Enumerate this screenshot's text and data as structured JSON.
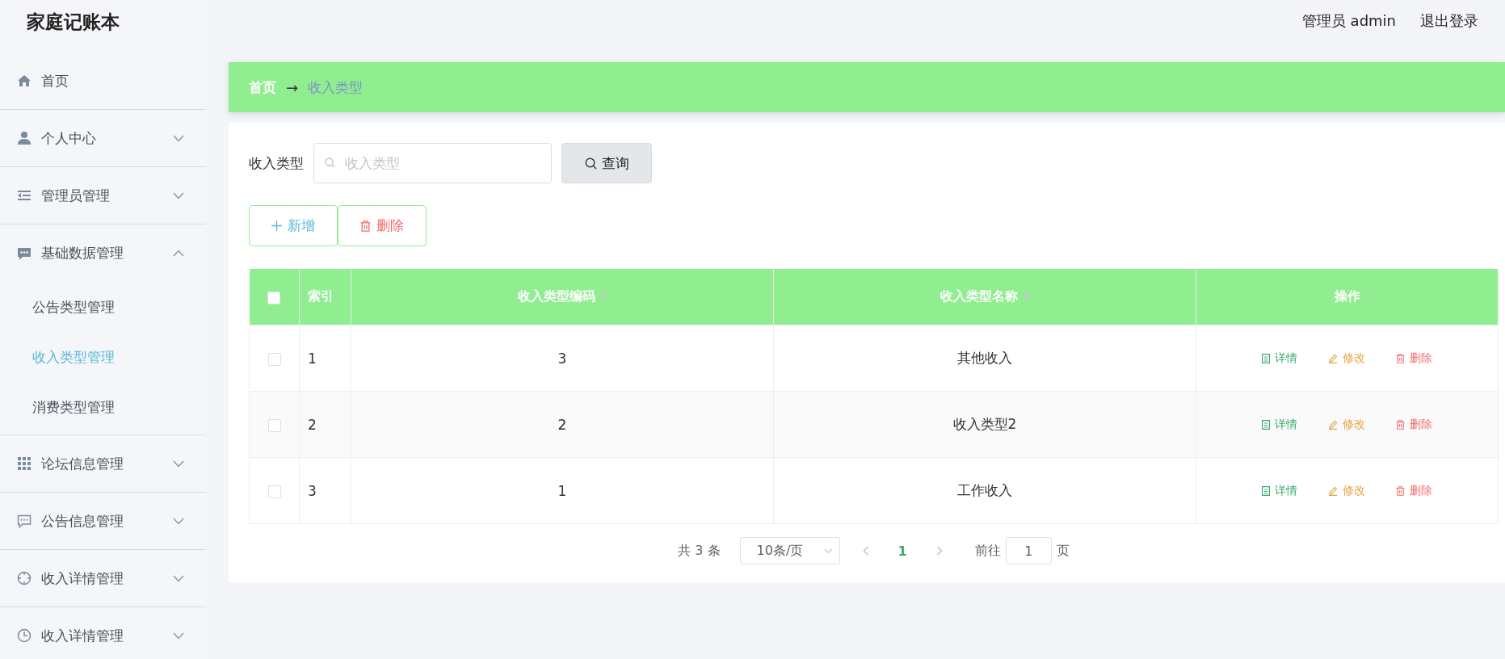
{
  "app": {
    "title": "家庭记账本"
  },
  "header": {
    "user": "管理员 admin",
    "logout": "退出登录"
  },
  "sidebar": {
    "items": [
      {
        "kind": "link",
        "label": "首页"
      },
      {
        "kind": "group",
        "label": "个人中心",
        "expanded": false
      },
      {
        "kind": "group",
        "label": "管理员管理",
        "expanded": false
      },
      {
        "kind": "group",
        "label": "基础数据管理",
        "expanded": true,
        "children": [
          {
            "label": "公告类型管理",
            "selected": false
          },
          {
            "label": "收入类型管理",
            "selected": true
          },
          {
            "label": "消费类型管理",
            "selected": false
          }
        ]
      },
      {
        "kind": "group",
        "label": "论坛信息管理",
        "expanded": false
      },
      {
        "kind": "group",
        "label": "公告信息管理",
        "expanded": false
      },
      {
        "kind": "group",
        "label": "收入详情管理",
        "expanded": false
      },
      {
        "kind": "group",
        "label": "收入详情管理",
        "expanded": false
      }
    ]
  },
  "breadcrumb": {
    "items": [
      "首页",
      "收入类型"
    ],
    "separator": "→"
  },
  "search": {
    "label": "收入类型",
    "placeholder": "收入类型",
    "button": "查询"
  },
  "actions": [
    {
      "kind": "add",
      "label": "新增"
    },
    {
      "kind": "delete",
      "label": "删除"
    }
  ],
  "table": {
    "all_checked": false,
    "columns": [
      {
        "label": "索引",
        "sortable": false
      },
      {
        "label": "收入类型编码",
        "sortable": true
      },
      {
        "label": "收入类型名称",
        "sortable": true
      },
      {
        "label": "操作",
        "sortable": false
      }
    ],
    "rows": [
      {
        "checked": false,
        "index": "1",
        "code": "3",
        "name": "其他收入",
        "actions": [
          {
            "kind": "detail",
            "label": "详情"
          },
          {
            "kind": "edit",
            "label": "修改"
          },
          {
            "kind": "delete",
            "label": "删除"
          }
        ]
      },
      {
        "checked": false,
        "index": "2",
        "code": "2",
        "name": "收入类型2",
        "actions": [
          {
            "kind": "detail",
            "label": "详情"
          },
          {
            "kind": "edit",
            "label": "修改"
          },
          {
            "kind": "delete",
            "label": "删除"
          }
        ]
      },
      {
        "checked": false,
        "index": "3",
        "code": "1",
        "name": "工作收入",
        "actions": [
          {
            "kind": "detail",
            "label": "详情"
          },
          {
            "kind": "edit",
            "label": "修改"
          },
          {
            "kind": "delete",
            "label": "删除"
          }
        ]
      }
    ]
  },
  "pagination": {
    "total": "共 3 条",
    "page_size": "10条/页",
    "pages": [
      {
        "label": "1",
        "selected": true
      }
    ],
    "goto_label": "前往",
    "goto_value": "1",
    "goto_suffix": "页"
  }
}
